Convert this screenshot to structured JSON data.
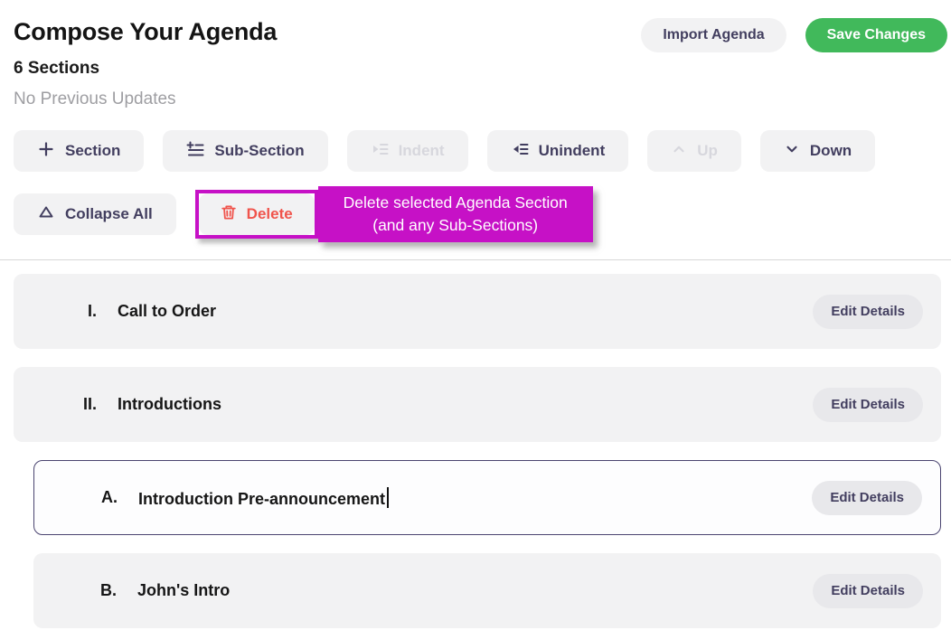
{
  "header": {
    "title": "Compose Your Agenda",
    "section_count": "6 Sections",
    "updates_note": "No Previous Updates",
    "import_label": "Import Agenda",
    "save_label": "Save Changes"
  },
  "toolbar": {
    "row1": [
      {
        "label": "Section",
        "icon": "plus-icon",
        "disabled": false
      },
      {
        "label": "Sub-Section",
        "icon": "add-subsection-icon",
        "disabled": false
      },
      {
        "label": "Indent",
        "icon": "indent-icon",
        "disabled": true
      },
      {
        "label": "Unindent",
        "icon": "unindent-icon",
        "disabled": false
      },
      {
        "label": "Up",
        "icon": "chevron-up-icon",
        "disabled": true
      },
      {
        "label": "Down",
        "icon": "chevron-down-icon",
        "disabled": false
      }
    ],
    "collapse_label": "Collapse All",
    "collapse_icon": "triangle-up-icon",
    "delete_label": "Delete",
    "delete_icon": "trash-icon"
  },
  "annotation": {
    "tooltip_line1": "Delete selected Agenda Section",
    "tooltip_line2": "(and any Sub-Sections)"
  },
  "sections": [
    {
      "numeral": "I.",
      "label": "Call to Order",
      "level": 1,
      "selected": false,
      "edit_label": "Edit Details"
    },
    {
      "numeral": "II.",
      "label": "Introductions",
      "level": 1,
      "selected": false,
      "edit_label": "Edit Details"
    },
    {
      "numeral": "A.",
      "label": "Introduction Pre-announcement",
      "level": 2,
      "selected": true,
      "edit_label": "Edit Details"
    },
    {
      "numeral": "B.",
      "label": "John's Intro",
      "level": 2,
      "selected": false,
      "edit_label": "Edit Details"
    }
  ],
  "colors": {
    "accent_purple": "#423e5f",
    "save_green": "#41b95b",
    "delete_red": "#f0544c",
    "annotation_magenta": "#c611c6",
    "row_gray": "#f2f2f3",
    "selected_border": "#4a4470"
  }
}
